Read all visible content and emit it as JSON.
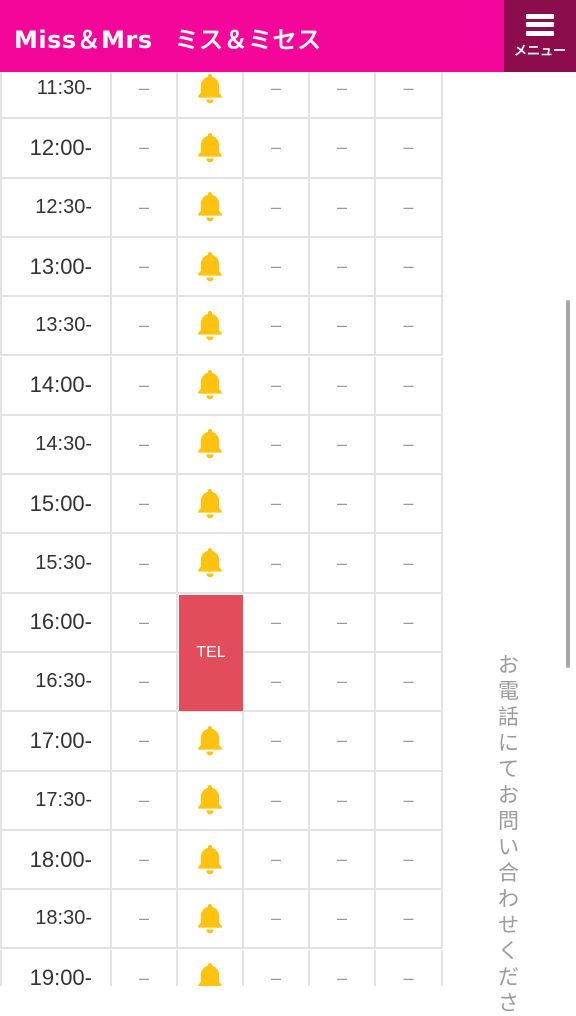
{
  "header": {
    "title_en": "Miss＆Mrs",
    "title_jp": "ミス＆ミセス",
    "menu_label": "メニュー",
    "brand_color": "#f5069a",
    "menu_bg_color": "#8b0d4c"
  },
  "schedule": {
    "empty_mark": "–",
    "tel_label": "TEL",
    "tel_color": "#e24d5c",
    "bell_color": "#ffc20e",
    "rows": [
      {
        "time": "11:30-",
        "cells": [
          "–",
          "bell",
          "–",
          "–",
          "–"
        ]
      },
      {
        "time": "12:00-",
        "cells": [
          "–",
          "bell",
          "–",
          "–",
          "–"
        ]
      },
      {
        "time": "12:30-",
        "cells": [
          "–",
          "bell",
          "–",
          "–",
          "–"
        ]
      },
      {
        "time": "13:00-",
        "cells": [
          "–",
          "bell",
          "–",
          "–",
          "–"
        ]
      },
      {
        "time": "13:30-",
        "cells": [
          "–",
          "bell",
          "–",
          "–",
          "–"
        ]
      },
      {
        "time": "14:00-",
        "cells": [
          "–",
          "bell",
          "–",
          "–",
          "–"
        ]
      },
      {
        "time": "14:30-",
        "cells": [
          "–",
          "bell",
          "–",
          "–",
          "–"
        ]
      },
      {
        "time": "15:00-",
        "cells": [
          "–",
          "bell",
          "–",
          "–",
          "–"
        ]
      },
      {
        "time": "15:30-",
        "cells": [
          "–",
          "bell",
          "–",
          "–",
          "–"
        ]
      },
      {
        "time": "16:00-",
        "cells": [
          "–",
          "tel",
          "–",
          "–",
          "–"
        ]
      },
      {
        "time": "16:30-",
        "cells": [
          "–",
          "tel",
          "–",
          "–",
          "–"
        ]
      },
      {
        "time": "17:00-",
        "cells": [
          "–",
          "bell",
          "–",
          "–",
          "–"
        ]
      },
      {
        "time": "17:30-",
        "cells": [
          "–",
          "bell",
          "–",
          "–",
          "–"
        ]
      },
      {
        "time": "18:00-",
        "cells": [
          "–",
          "bell",
          "–",
          "–",
          "–"
        ]
      },
      {
        "time": "18:30-",
        "cells": [
          "–",
          "bell",
          "–",
          "–",
          "–"
        ]
      },
      {
        "time": "19:00-",
        "cells": [
          "–",
          "bell",
          "–",
          "–",
          "–"
        ]
      }
    ]
  },
  "side_note": "お電話にてお問い合わせくださ"
}
